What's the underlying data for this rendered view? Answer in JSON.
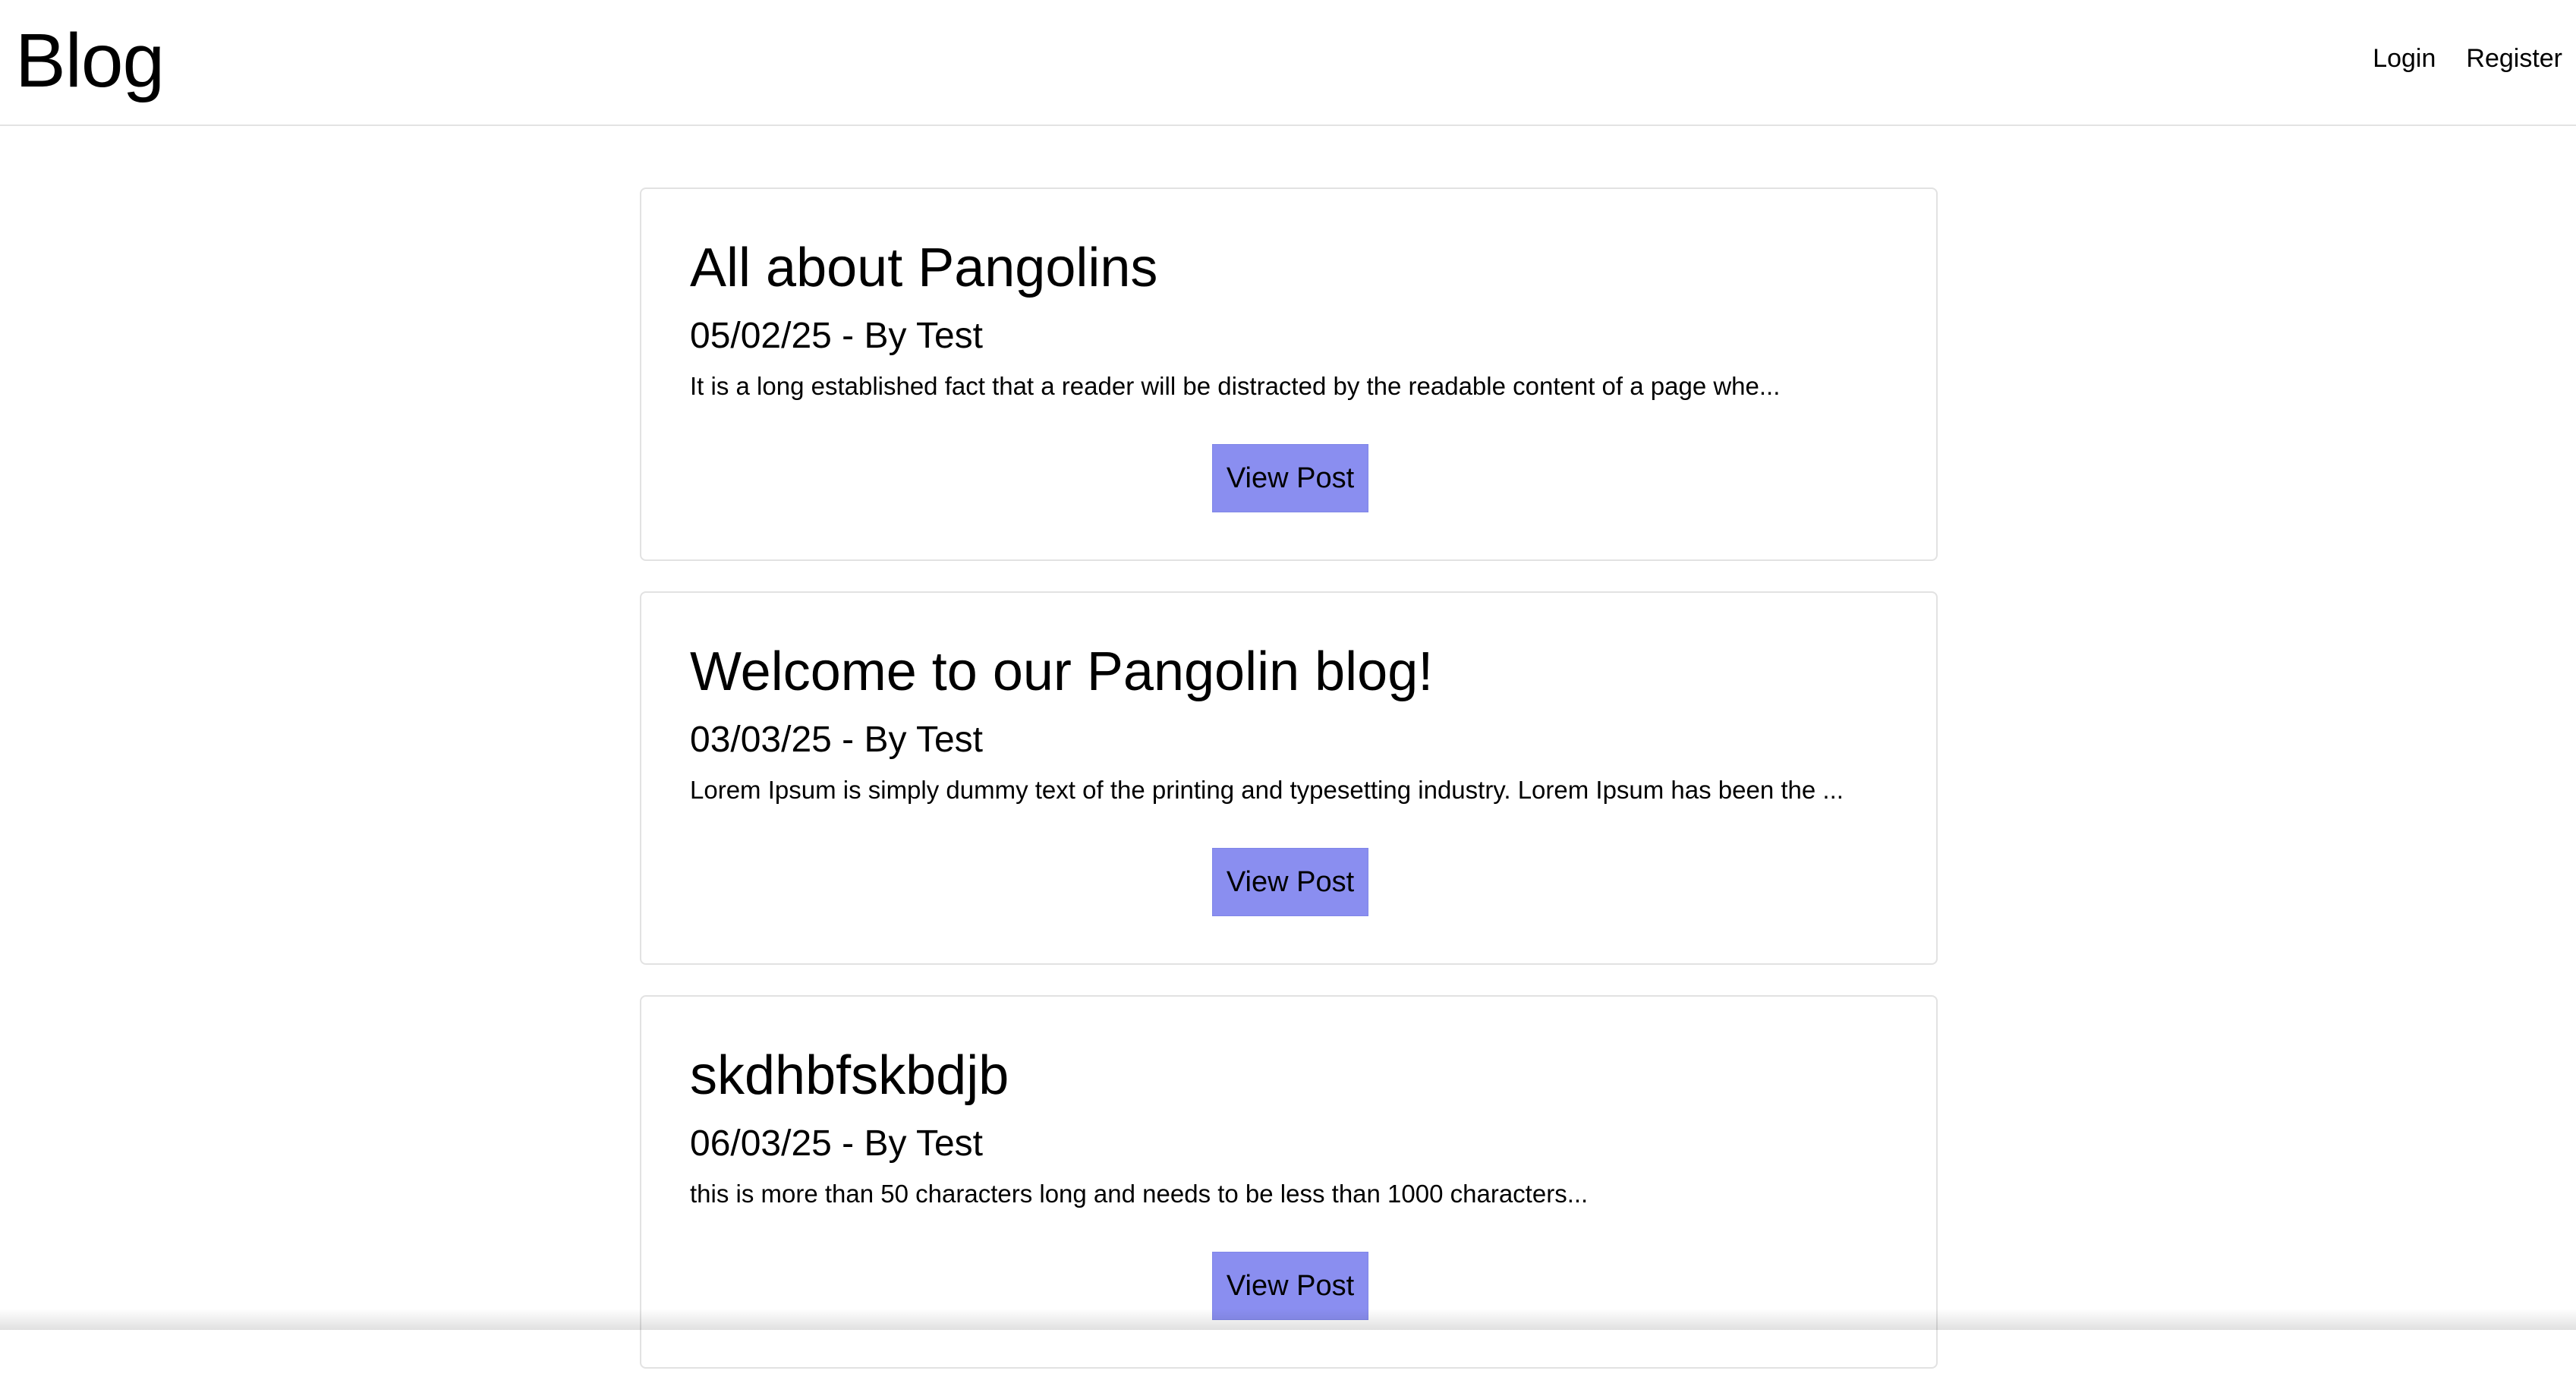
{
  "header": {
    "brand": "Blog",
    "nav": {
      "login": "Login",
      "register": "Register"
    }
  },
  "posts": [
    {
      "title": "All about Pangolins",
      "meta": "05/02/25 - By Test",
      "excerpt": "It is a long established fact that a reader will be distracted by the readable content of a page whe...",
      "button": "View Post"
    },
    {
      "title": "Welcome to our Pangolin blog!",
      "meta": "03/03/25 - By Test",
      "excerpt": "Lorem Ipsum is simply dummy text of the printing and typesetting industry. Lorem Ipsum has been the ...",
      "button": "View Post"
    },
    {
      "title": "skdhbfskbdjb",
      "meta": "06/03/25 - By Test",
      "excerpt": "this is more than 50 characters long and needs to be less than 1000 characters...",
      "button": "View Post"
    }
  ],
  "colors": {
    "button": "#8a8ef0",
    "border": "#e2e2e2",
    "background": "#ffffff",
    "text": "#000000"
  }
}
